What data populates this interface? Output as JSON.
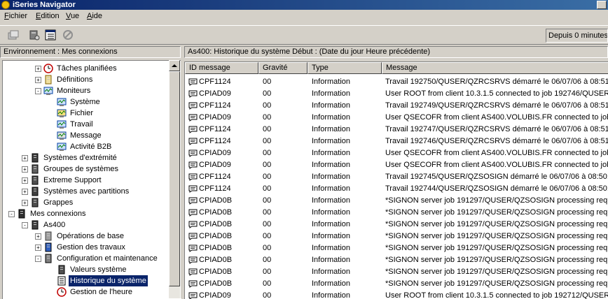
{
  "window": {
    "title": "iSeries Navigator"
  },
  "menu": [
    "Fichier",
    "Edition",
    "Vue",
    "Aide"
  ],
  "toolbar": {
    "icons": [
      "properties-icon",
      "network-icon",
      "tree-view-icon",
      "stop-icon"
    ],
    "status": "Depuis 0 minutes"
  },
  "left_header": "Environnement : Mes connexions",
  "right_header": "As400:  Historique du système     Début : (Date du jour  Heure précédente)",
  "tree": [
    {
      "label": "Tâches planifiées",
      "level": 2,
      "expander": "+",
      "icon": "clock-icon",
      "name": "taches-planifiees"
    },
    {
      "label": "Définitions",
      "level": 2,
      "expander": "+",
      "icon": "definitions-icon",
      "name": "definitions"
    },
    {
      "label": "Moniteurs",
      "level": 2,
      "expander": "-",
      "icon": "monitor-icon",
      "name": "moniteurs"
    },
    {
      "label": "Système",
      "level": 3,
      "expander": "",
      "icon": "monitor-icon",
      "name": "systeme"
    },
    {
      "label": "Fichier",
      "level": 3,
      "expander": "",
      "icon": "monitor-file-icon",
      "name": "fichier"
    },
    {
      "label": "Travail",
      "level": 3,
      "expander": "",
      "icon": "monitor-job-icon",
      "name": "travail"
    },
    {
      "label": "Message",
      "level": 3,
      "expander": "",
      "icon": "monitor-message-icon",
      "name": "message"
    },
    {
      "label": "Activité B2B",
      "level": 3,
      "expander": "",
      "icon": "monitor-b2b-icon",
      "name": "activite-b2b"
    },
    {
      "label": "Systèmes d'extrémité",
      "level": 1,
      "expander": "+",
      "icon": "server-icon",
      "name": "systemes-extremite"
    },
    {
      "label": "Groupes de systèmes",
      "level": 1,
      "expander": "+",
      "icon": "system-group-icon",
      "name": "groupes-systemes"
    },
    {
      "label": "Extreme Support",
      "level": 1,
      "expander": "+",
      "icon": "support-icon",
      "name": "extreme-support"
    },
    {
      "label": "Systèmes avec partitions",
      "level": 1,
      "expander": "+",
      "icon": "partition-icon",
      "name": "systemes-partitions"
    },
    {
      "label": "Grappes",
      "level": 1,
      "expander": "+",
      "icon": "cluster-icon",
      "name": "grappes"
    },
    {
      "label": "Mes connexions",
      "level": 0,
      "expander": "-",
      "icon": "connections-icon",
      "name": "mes-connexions"
    },
    {
      "label": "As400",
      "level": 1,
      "expander": "-",
      "icon": "server-icon",
      "name": "as400"
    },
    {
      "label": "Opérations de base",
      "level": 2,
      "expander": "+",
      "icon": "basic-operations-icon",
      "name": "operations-base"
    },
    {
      "label": "Gestion des travaux",
      "level": 2,
      "expander": "+",
      "icon": "work-management-icon",
      "name": "gestion-travaux"
    },
    {
      "label": "Configuration et maintenance",
      "level": 2,
      "expander": "-",
      "icon": "configuration-icon",
      "name": "configuration-maintenance"
    },
    {
      "label": "Valeurs système",
      "level": 3,
      "expander": "",
      "icon": "system-values-icon",
      "name": "valeurs-systeme"
    },
    {
      "label": "Historique du système",
      "level": 3,
      "expander": "",
      "icon": "history-icon",
      "name": "historique-systeme",
      "selected": true
    },
    {
      "label": "Gestion de l'heure",
      "level": 3,
      "expander": "",
      "icon": "clock-icon",
      "name": "gestion-heure"
    }
  ],
  "columns": [
    "ID message",
    "Gravité",
    "Type",
    "Message"
  ],
  "rows": [
    [
      "CPF1124",
      "00",
      "Information",
      "Travail 192750/QUSER/QZRCSRVS démarré le 06/07/06 à 08:51:1"
    ],
    [
      "CPIAD09",
      "00",
      "Information",
      "User ROOT from client 10.3.1.5 connected to job 192746/QUSER/"
    ],
    [
      "CPF1124",
      "00",
      "Information",
      "Travail 192749/QUSER/QZRCSRVS démarré le 06/07/06 à 08:51:1"
    ],
    [
      "CPIAD09",
      "00",
      "Information",
      "User QSECOFR from client AS400.VOLUBIS.FR connected to job 1"
    ],
    [
      "CPF1124",
      "00",
      "Information",
      "Travail 192747/QUSER/QZRCSRVS démarré le 06/07/06 à 08:51:0"
    ],
    [
      "CPF1124",
      "00",
      "Information",
      "Travail 192746/QUSER/QZRCSRVS démarré le 06/07/06 à 08:51:0"
    ],
    [
      "CPIAD09",
      "00",
      "Information",
      "User QSECOFR from client AS400.VOLUBIS.FR connected to job 1"
    ],
    [
      "CPIAD09",
      "00",
      "Information",
      "User QSECOFR from client AS400.VOLUBIS.FR connected to job 1"
    ],
    [
      "CPF1124",
      "00",
      "Information",
      "Travail 192745/QUSER/QZSOSIGN démarré le 06/07/06 à 08:50:5"
    ],
    [
      "CPF1124",
      "00",
      "Information",
      "Travail 192744/QUSER/QZSOSIGN démarré le 06/07/06 à 08:50:5"
    ],
    [
      "CPIAD0B",
      "00",
      "Information",
      "*SIGNON server job 191297/QUSER/QZSOSIGN processing reque"
    ],
    [
      "CPIAD0B",
      "00",
      "Information",
      "*SIGNON server job 191297/QUSER/QZSOSIGN processing reque"
    ],
    [
      "CPIAD0B",
      "00",
      "Information",
      "*SIGNON server job 191297/QUSER/QZSOSIGN processing reque"
    ],
    [
      "CPIAD0B",
      "00",
      "Information",
      "*SIGNON server job 191297/QUSER/QZSOSIGN processing reque"
    ],
    [
      "CPIAD0B",
      "00",
      "Information",
      "*SIGNON server job 191297/QUSER/QZSOSIGN processing reque"
    ],
    [
      "CPIAD0B",
      "00",
      "Information",
      "*SIGNON server job 191297/QUSER/QZSOSIGN processing reque"
    ],
    [
      "CPIAD0B",
      "00",
      "Information",
      "*SIGNON server job 191297/QUSER/QZSOSIGN processing reque"
    ],
    [
      "CPIAD0B",
      "00",
      "Information",
      "*SIGNON server job 191297/QUSER/QZSOSIGN processing reque"
    ],
    [
      "CPIAD09",
      "00",
      "Information",
      "User ROOT from client 10.3.1.5 connected to job 192712/QUSER/"
    ]
  ]
}
